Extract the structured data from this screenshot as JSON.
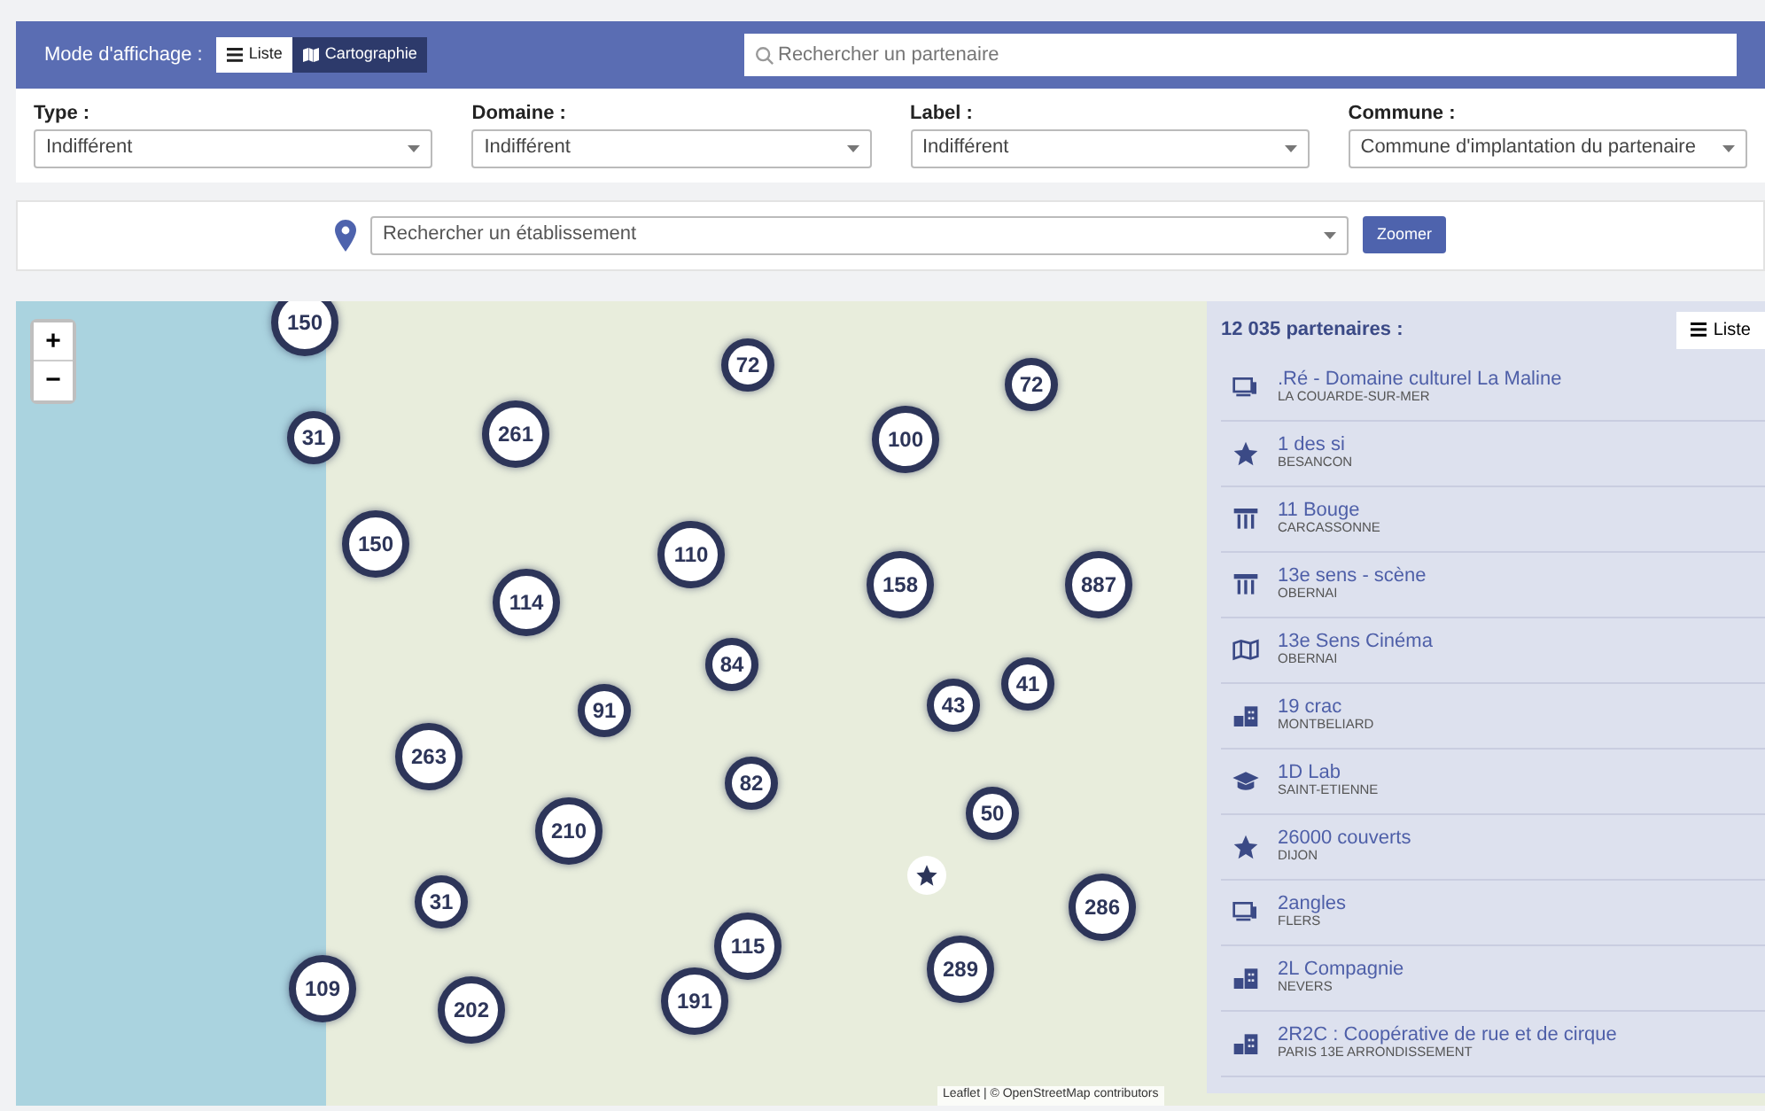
{
  "display_mode": {
    "label": "Mode d'affichage :",
    "options": [
      {
        "label": "Liste",
        "selected": false
      },
      {
        "label": "Cartographie",
        "selected": true
      }
    ]
  },
  "partner_search": {
    "placeholder": "Rechercher un partenaire"
  },
  "filters": [
    {
      "label": "Type :",
      "value": "Indifférent"
    },
    {
      "label": "Domaine :",
      "value": "Indifférent"
    },
    {
      "label": "Label :",
      "value": "Indifférent"
    },
    {
      "label": "Commune :",
      "value": "Commune d'implantation du partenaire"
    }
  ],
  "establishment_search": {
    "placeholder": "Rechercher un établissement",
    "button": "Zoomer"
  },
  "map": {
    "zoom_in": "+",
    "zoom_out": "−",
    "attribution": "Leaflet | © OpenStreetMap contributors",
    "clusters": [
      {
        "count": "150"
      },
      {
        "count": "31"
      },
      {
        "count": "261"
      },
      {
        "count": "72"
      },
      {
        "count": "72"
      },
      {
        "count": "100"
      },
      {
        "count": "150"
      },
      {
        "count": "110"
      },
      {
        "count": "158"
      },
      {
        "count": "887"
      },
      {
        "count": "114"
      },
      {
        "count": "84"
      },
      {
        "count": "91"
      },
      {
        "count": "43"
      },
      {
        "count": "41"
      },
      {
        "count": "263"
      },
      {
        "count": "82"
      },
      {
        "count": "50"
      },
      {
        "count": "210"
      },
      {
        "count": "286"
      },
      {
        "count": "31"
      },
      {
        "count": "115"
      },
      {
        "count": "289"
      },
      {
        "count": "109"
      },
      {
        "count": "202"
      },
      {
        "count": "191"
      }
    ]
  },
  "results": {
    "count": "12 035 partenaires :",
    "list_button": "Liste",
    "items": [
      {
        "kind": "screen",
        "name": ".Ré - Domaine culturel La Maline",
        "city": "LA COUARDE-SUR-MER"
      },
      {
        "kind": "star",
        "name": "1 des si",
        "city": "BESANCON"
      },
      {
        "kind": "columns",
        "name": "11 Bouge",
        "city": "CARCASSONNE"
      },
      {
        "kind": "columns",
        "name": "13e sens - scène",
        "city": "OBERNAI"
      },
      {
        "kind": "map",
        "name": "13e Sens Cinéma",
        "city": "OBERNAI"
      },
      {
        "kind": "buildings",
        "name": "19 crac",
        "city": "MONTBELIARD"
      },
      {
        "kind": "cap",
        "name": "1D Lab",
        "city": "SAINT-ETIENNE"
      },
      {
        "kind": "star",
        "name": "26000 couverts",
        "city": "DIJON"
      },
      {
        "kind": "screen",
        "name": "2angles",
        "city": "FLERS"
      },
      {
        "kind": "buildings",
        "name": "2L Compagnie",
        "city": "NEVERS"
      },
      {
        "kind": "buildings",
        "name": "2R2C : Coopérative de rue et de cirque",
        "city": "PARIS 13E ARRONDISSEMENT"
      }
    ]
  }
}
